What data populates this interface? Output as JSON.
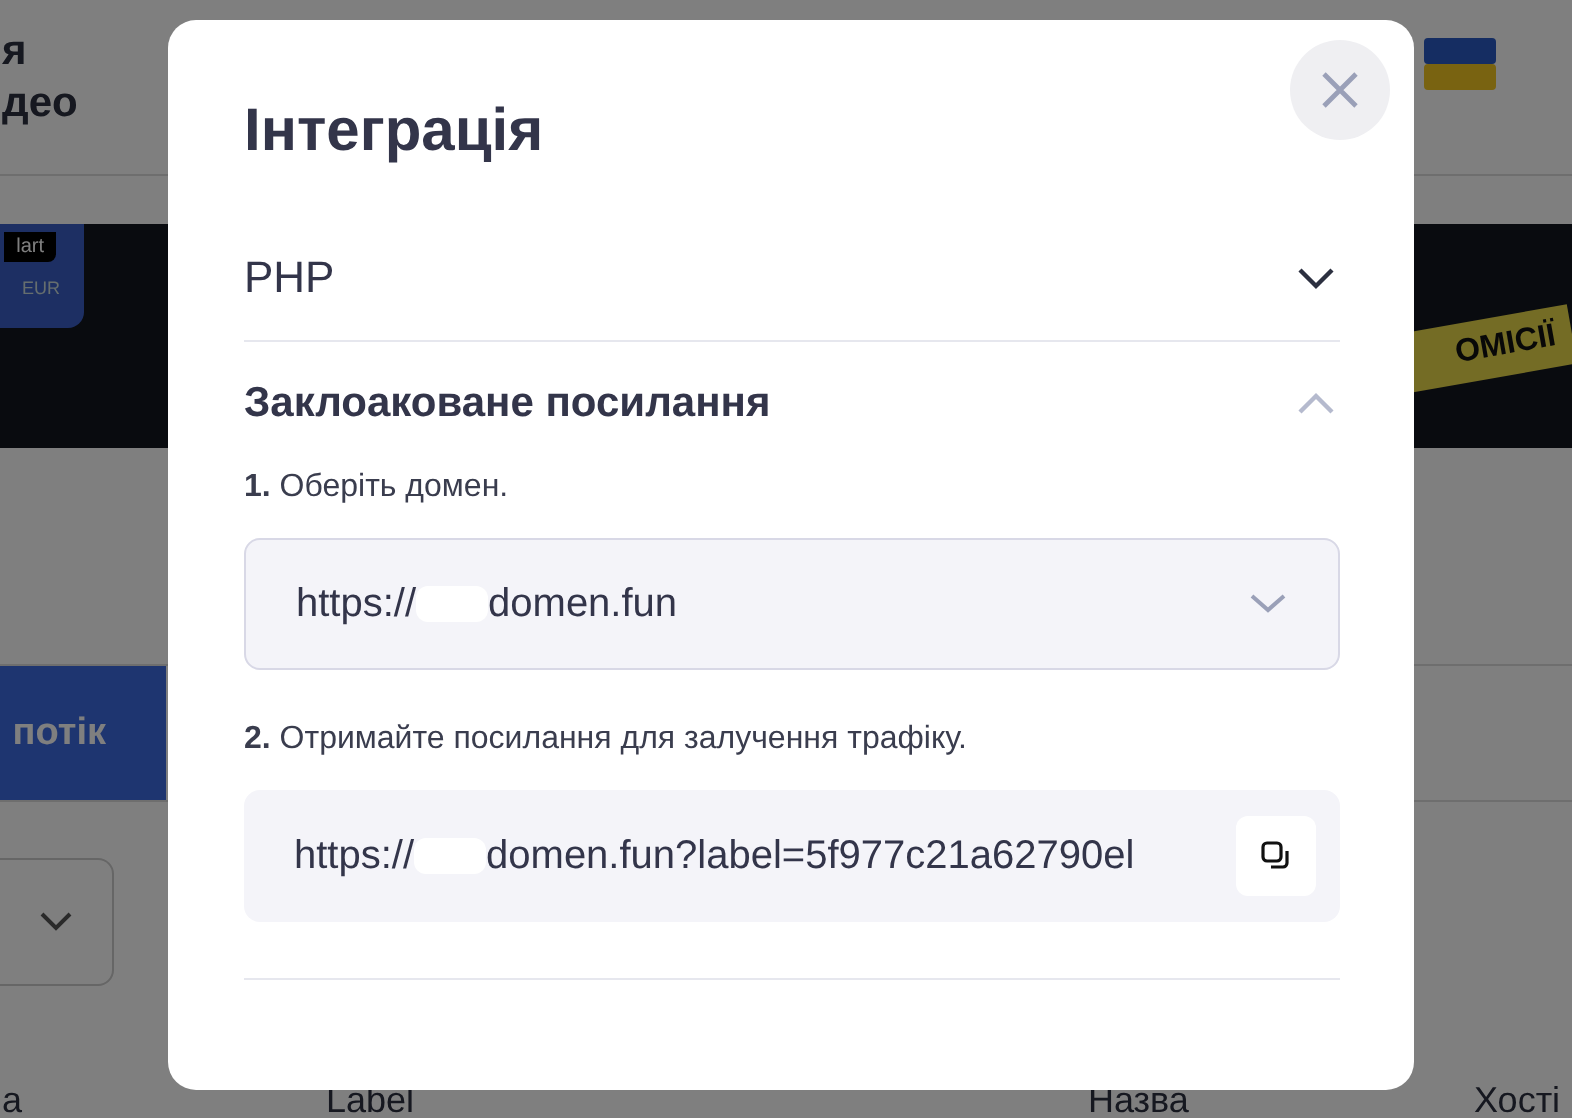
{
  "background": {
    "header_text_lines": [
      "я",
      "део"
    ],
    "banner": {
      "card_texts": [
        "lart",
        "EUR"
      ],
      "tape_text": "ОМІСІЇ"
    },
    "tab_button": "потік",
    "table_headers": [
      "а",
      "Label",
      "Назва",
      "Хості"
    ]
  },
  "modal": {
    "title": "Інтеграція",
    "sections": [
      {
        "title": "PHP",
        "expanded": false
      },
      {
        "title": "Заклоаковане посилання",
        "expanded": true,
        "steps": [
          {
            "kind": "select",
            "text": "**1.** Оберіть домен.",
            "url_prefix": "https://",
            "url_rest": "domen.fun"
          },
          {
            "kind": "copy",
            "text": "**2.** Отримайте посилання для залучення трафіку.",
            "url_prefix": "https://",
            "url_rest": "domen.fun?label=5f977c21a62790el"
          }
        ]
      }
    ]
  }
}
